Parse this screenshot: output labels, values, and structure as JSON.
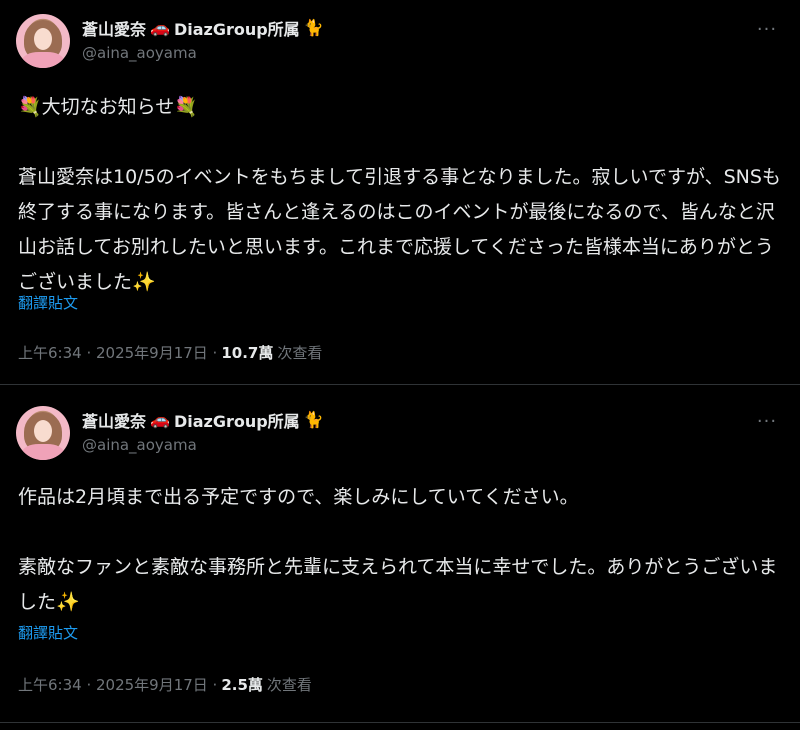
{
  "tweets": [
    {
      "author_name": "蒼山愛奈",
      "author_suffix": "DiazGroup所属",
      "emoji_car": "🚗",
      "emoji_cat": "🐈",
      "handle": "@aina_aoyama",
      "more_label": "···",
      "body": "💐大切なお知らせ💐\n\n蒼山愛奈は10/5のイベントをもちまして引退する事となりました。寂しいですが、SNSも終了する事になります。皆さんと逢えるのはこのイベントが最後になるので、皆んなと沢山お話してお別れしたいと思います。これまで応援してくださった皆様本当にありがとうございました✨",
      "translate_label": "翻譯貼文",
      "time": "上午6:34 · 2025年9月17日 ·",
      "views": "10.7萬",
      "views_label": "次查看"
    },
    {
      "author_name": "蒼山愛奈",
      "author_suffix": "DiazGroup所属",
      "emoji_car": "🚗",
      "emoji_cat": "🐈",
      "handle": "@aina_aoyama",
      "more_label": "···",
      "body": "作品は2月頃まで出る予定ですので、楽しみにしていてください。\n\n素敵なファンと素敵な事務所と先輩に支えられて本当に幸せでした。ありがとうございました✨",
      "translate_label": "翻譯貼文",
      "time": "上午6:34 · 2025年9月17日 ·",
      "views": "2.5萬",
      "views_label": "次查看"
    }
  ]
}
